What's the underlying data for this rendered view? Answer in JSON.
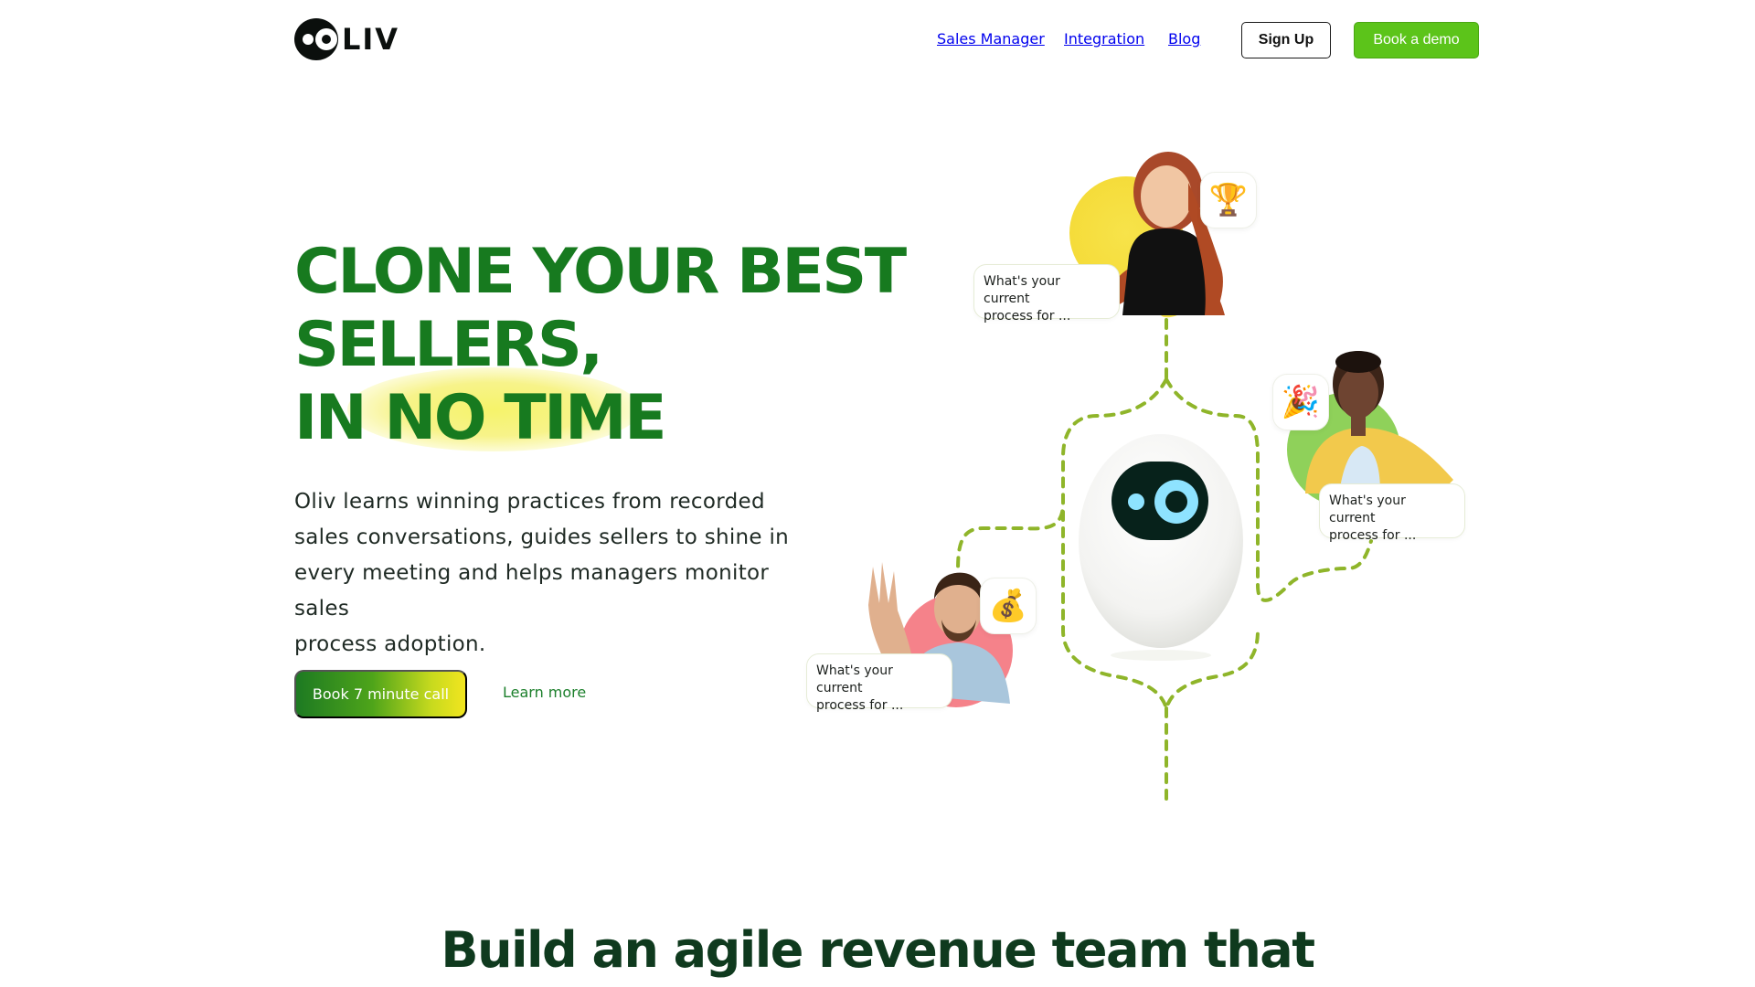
{
  "brand": {
    "name": "LIV"
  },
  "nav": {
    "items": [
      "Sales Manager",
      "Integration",
      "Blog"
    ],
    "signup_label": "Sign Up",
    "demo_label": "Book a demo"
  },
  "hero": {
    "headline_lines": [
      "CLONE YOUR BEST",
      "SELLERS,",
      "IN NO TIME"
    ],
    "description": "Oliv learns winning practices from recorded sales conversations, guides sellers to shine in every meeting and helps managers monitor sales process adoption.",
    "description_lines": [
      "Oliv learns winning practices from recorded",
      "sales conversations, guides sellers to shine in",
      "every meeting and helps managers monitor sales",
      "process adoption."
    ],
    "cta_primary": "Book 7 minute call",
    "cta_secondary": "Learn more"
  },
  "illustration": {
    "bubbles": [
      {
        "line1": "What's your current",
        "line2": "process for ..."
      },
      {
        "line1": "What's your current",
        "line2": "process for ..."
      },
      {
        "line1": "What's your current",
        "line2": "process for ..."
      }
    ],
    "emoji_icons": [
      "trophy-icon",
      "party-popper-icon",
      "money-bag-icon"
    ],
    "emojis": [
      "🏆",
      "🎉",
      "💰"
    ],
    "colors": {
      "path": "#8fb52a",
      "yellow_blob": "#f7e34a",
      "green_blob": "#8fd15a",
      "pink_blob": "#f5828a"
    }
  },
  "section_next": {
    "heading": "Build an agile revenue team that"
  },
  "colors": {
    "headline_green": "#177a1f",
    "demo_button": "#5cc41a",
    "dark_green_heading": "#0f3a1e"
  }
}
